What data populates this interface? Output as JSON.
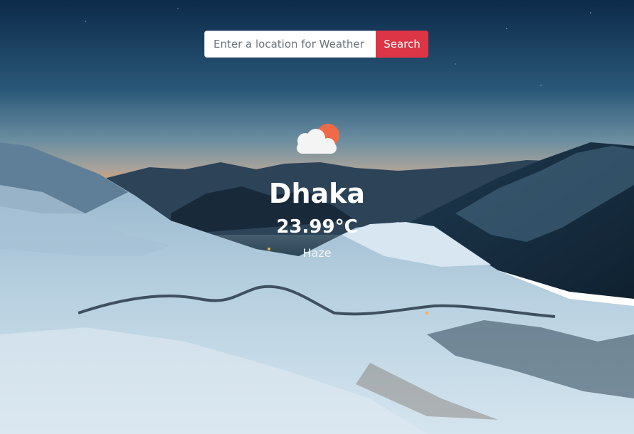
{
  "search": {
    "placeholder": "Enter a location for Weather ...",
    "value": "",
    "button_label": "Search"
  },
  "weather": {
    "icon": "partly-cloudy-icon",
    "city": "Dhaka",
    "temperature": "23.99°C",
    "condition": "Haze"
  },
  "colors": {
    "search_button": "#dc3545",
    "sun": "#ef6b47",
    "cloud": "#f4f4f4",
    "sky_top": "#0d2a4a",
    "snow": "#c9dde9"
  }
}
